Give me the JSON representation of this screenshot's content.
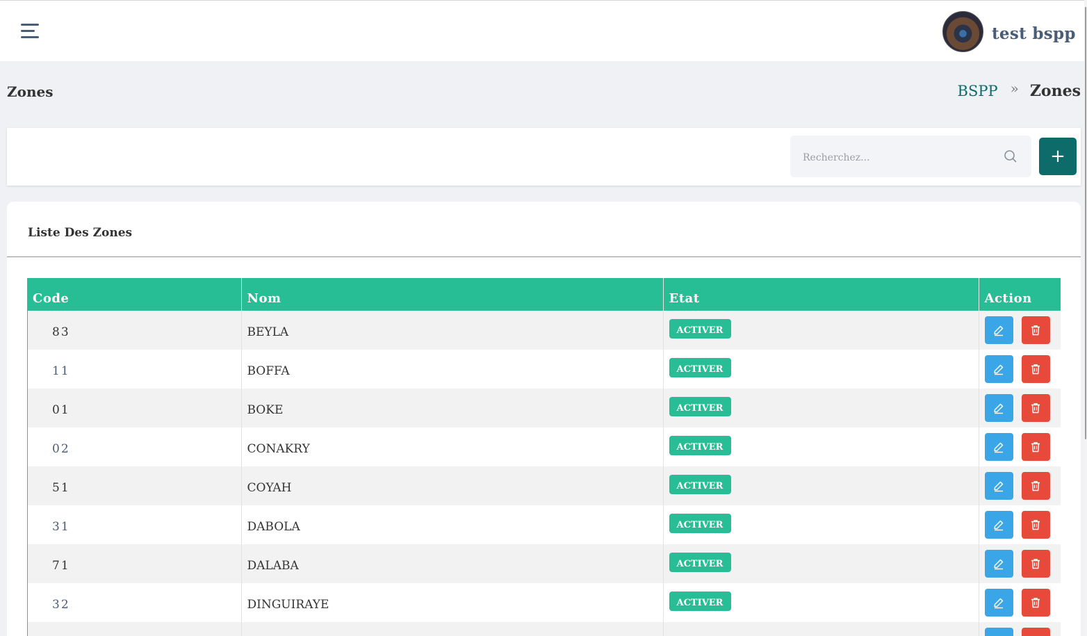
{
  "header": {
    "username": "test bspp"
  },
  "page": {
    "title": "Zones"
  },
  "breadcrumb": {
    "root": "BSPP",
    "separator": "»",
    "current": "Zones"
  },
  "toolbar": {
    "search_placeholder": "Recherchez...",
    "add_label": "+"
  },
  "list": {
    "title": "Liste Des Zones",
    "columns": [
      "Code",
      "Nom",
      "Etat",
      "Action"
    ],
    "rows": [
      {
        "code": "83",
        "nom": "BEYLA",
        "etat": "ACTIVER"
      },
      {
        "code": "11",
        "nom": "BOFFA",
        "etat": "ACTIVER"
      },
      {
        "code": "01",
        "nom": "BOKE",
        "etat": "ACTIVER"
      },
      {
        "code": "02",
        "nom": "CONAKRY",
        "etat": "ACTIVER"
      },
      {
        "code": "51",
        "nom": "COYAH",
        "etat": "ACTIVER"
      },
      {
        "code": "31",
        "nom": "DABOLA",
        "etat": "ACTIVER"
      },
      {
        "code": "71",
        "nom": "DALABA",
        "etat": "ACTIVER"
      },
      {
        "code": "32",
        "nom": "DINGUIRAYE",
        "etat": "ACTIVER"
      },
      {
        "code": "",
        "nom": "",
        "etat": ""
      }
    ]
  },
  "colors": {
    "primary": "#0d6b6a",
    "table_header": "#27be96",
    "edit_button": "#3aa6e8",
    "delete_button": "#e74a3b",
    "status_badge": "#27be96"
  },
  "icons": {
    "menu": "hamburger-menu-icon",
    "search": "search-icon",
    "edit": "pencil-icon",
    "delete": "trash-icon"
  }
}
